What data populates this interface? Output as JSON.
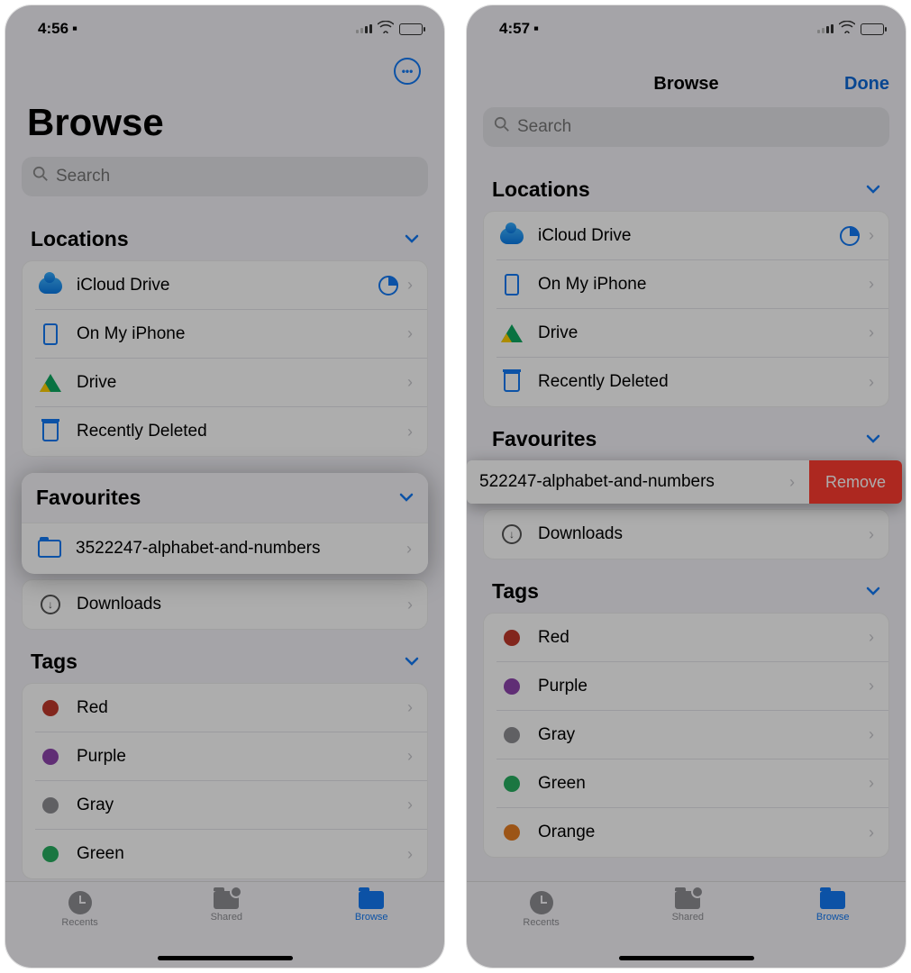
{
  "left": {
    "status": {
      "time": "4:56",
      "has_signal": true,
      "has_wifi": true,
      "has_battery": true
    },
    "title": "Browse",
    "search_placeholder": "Search",
    "sections": {
      "locations": {
        "title": "Locations",
        "items": [
          {
            "label": "iCloud Drive",
            "icon": "cloud",
            "storage_indicator": true
          },
          {
            "label": "On My iPhone",
            "icon": "iphone"
          },
          {
            "label": "Drive",
            "icon": "gdrive"
          },
          {
            "label": "Recently Deleted",
            "icon": "trash"
          }
        ]
      },
      "favourites": {
        "title": "Favourites",
        "items": [
          {
            "label": "3522247-alphabet-and-numbers",
            "icon": "folder"
          }
        ]
      },
      "downloads_label": "Downloads",
      "tags": {
        "title": "Tags",
        "items": [
          {
            "label": "Red",
            "color": "#c0392b"
          },
          {
            "label": "Purple",
            "color": "#8e44ad"
          },
          {
            "label": "Gray",
            "color": "#8e8e93"
          },
          {
            "label": "Green",
            "color": "#27ae60"
          }
        ]
      }
    },
    "tabs": [
      {
        "label": "Recents",
        "active": false
      },
      {
        "label": "Shared",
        "active": false
      },
      {
        "label": "Browse",
        "active": true
      }
    ]
  },
  "right": {
    "status": {
      "time": "4:57"
    },
    "nav_title": "Browse",
    "done_label": "Done",
    "search_placeholder": "Search",
    "sections": {
      "locations": {
        "title": "Locations",
        "items": [
          {
            "label": "iCloud Drive",
            "icon": "cloud",
            "storage_indicator": true
          },
          {
            "label": "On My iPhone",
            "icon": "iphone"
          },
          {
            "label": "Drive",
            "icon": "gdrive"
          },
          {
            "label": "Recently Deleted",
            "icon": "trash"
          }
        ]
      },
      "favourites": {
        "title": "Favourites",
        "swipe_item": {
          "label_visible": "522247-alphabet-and-numbers",
          "action_label": "Remove"
        },
        "downloads_label": "Downloads"
      },
      "tags": {
        "title": "Tags",
        "items": [
          {
            "label": "Red",
            "color": "#c0392b"
          },
          {
            "label": "Purple",
            "color": "#8e44ad"
          },
          {
            "label": "Gray",
            "color": "#8e8e93"
          },
          {
            "label": "Green",
            "color": "#27ae60"
          },
          {
            "label": "Orange",
            "color": "#e67e22"
          }
        ]
      }
    },
    "tabs": [
      {
        "label": "Recents",
        "active": false
      },
      {
        "label": "Shared",
        "active": false
      },
      {
        "label": "Browse",
        "active": true
      }
    ]
  }
}
